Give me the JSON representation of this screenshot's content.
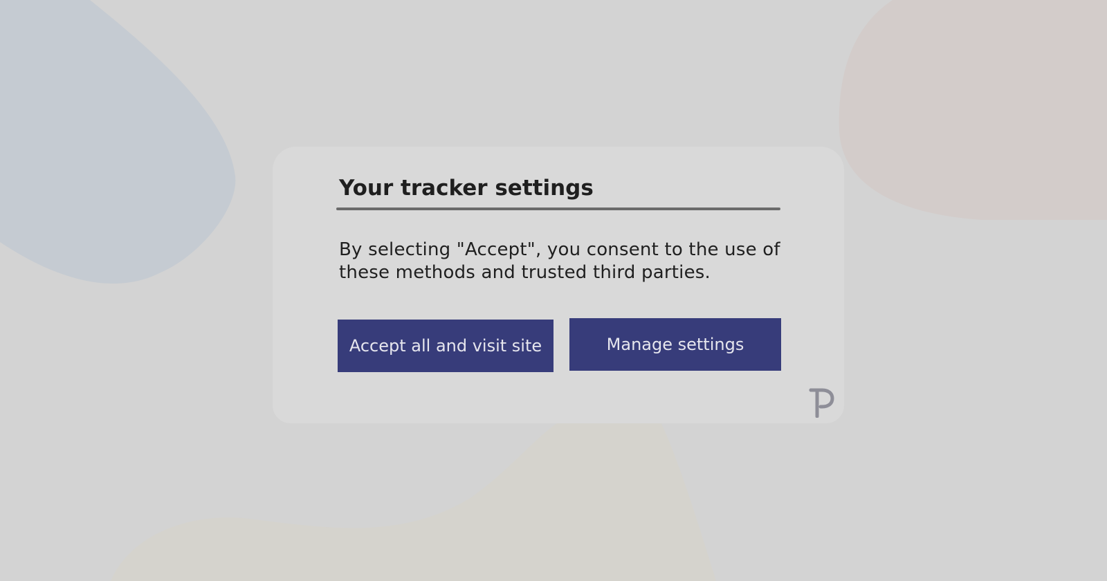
{
  "consent_dialog": {
    "title": "Your tracker settings",
    "body": "By selecting \"Accept\", you consent to the use of these methods and trusted third parties.",
    "accept_button_label": "Accept all and visit site",
    "manage_button_label": "Manage settings",
    "brand_logo_icon": "p-logo-icon"
  },
  "colors": {
    "page_background": "#d3d3d3",
    "dialog_background": "#d9d9d9",
    "button_background": "#373c7a",
    "button_text": "#e6e6ee",
    "title_text": "#1f1f1f",
    "underline": "#6b6b6b",
    "logo": "#8e8e98"
  }
}
